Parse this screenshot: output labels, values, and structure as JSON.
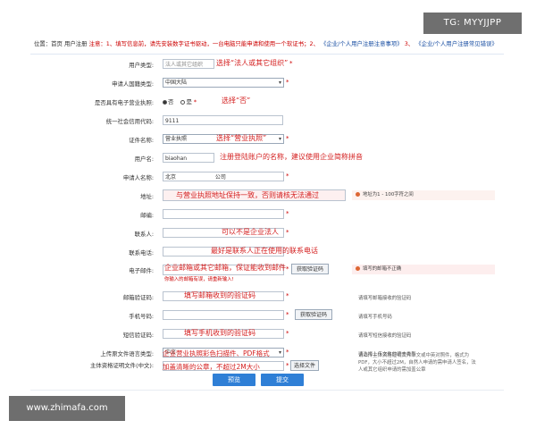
{
  "watermark_tl": "TG: MYYJJPP",
  "watermark_bl": "www.zhimafa.com",
  "topbar": {
    "loc": "位置：首页 用户注册",
    "note_red": "注意：1、填写信息前，请先安装数字证书驱动，一台电脑只能申请和使用一个软证书；2、",
    "link1": "《企业/个人用户注册注意事项》",
    "num3": "3、",
    "link2": "《企业/个人用户注册常见错误》"
  },
  "rows": {
    "user_type": {
      "label": "用户类型:",
      "value": "法人或其它组织",
      "anno": "选择“法人或其它组织”"
    },
    "country": {
      "label": "申请人国籍类型:",
      "value": "中国大陆"
    },
    "license": {
      "label": "是否具有电子营业执照:",
      "no": "否",
      "yes": "是",
      "anno": "选择“否”"
    },
    "credit_code": {
      "label": "统一社会信用代码:",
      "value": "9111"
    },
    "cert_name": {
      "label": "证件名称:",
      "value": "营业执照",
      "anno": "选择“营业执照”"
    },
    "username": {
      "label": "用户名:",
      "value": "biaohan",
      "anno": "注册登陆账户的名称，建议使用企业简称拼音"
    },
    "applicant": {
      "label": "申请人名称:",
      "value": "北京",
      "value2": "公司"
    },
    "address": {
      "label": "地址:",
      "anno": "与营业执照地址保持一致，否则请核无法通过",
      "warn": "地址为1 - 100字符之间"
    },
    "postcode": {
      "label": "邮编:"
    },
    "contact": {
      "label": "联系人:",
      "anno": "可以不是企业法人"
    },
    "phone": {
      "label": "联系电话:",
      "anno": "最好是联系人正在使用的联系电话"
    },
    "email": {
      "label": "电子邮件:",
      "anno": "企业邮箱或其它邮箱，保证能收到邮件",
      "sub": "你输入的邮箱有误，请重新输入!",
      "button": "获取验证码",
      "warn": "填写的邮箱不正确"
    },
    "email_code": {
      "label": "邮箱验证码:",
      "anno": "填写邮箱收到的验证码",
      "hint": "请填写邮箱接收的验证码"
    },
    "mobile": {
      "label": "手机号码:",
      "button": "获取验证码",
      "hint": "请填写手机号码"
    },
    "sms_code": {
      "label": "短信验证码:",
      "anno": "填写手机收到的验证码",
      "hint": "请填写短信接收的验证码"
    },
    "lang": {
      "label": "上传原文件语言类型:",
      "value": "中文",
      "hint": "请选择上传文件的语言类型"
    },
    "subject_doc": {
      "label": "主体资格证明文件(中文):",
      "anno1": "企业营业执照彩色扫描件、PDF格式",
      "anno2": "加盖清晰的公章，不超过2M大小",
      "button": "选择文件",
      "hint1": "请上传主体资格证明文件中文或中英对照件，格式为",
      "hint2": "PDF，大小不超过2M，自然人申请的需申请人签名，法",
      "hint3": "人或其它组织申请的需加盖公章"
    }
  },
  "buttons": {
    "preview": "预览",
    "submit": "提交"
  },
  "req_mark": "*"
}
